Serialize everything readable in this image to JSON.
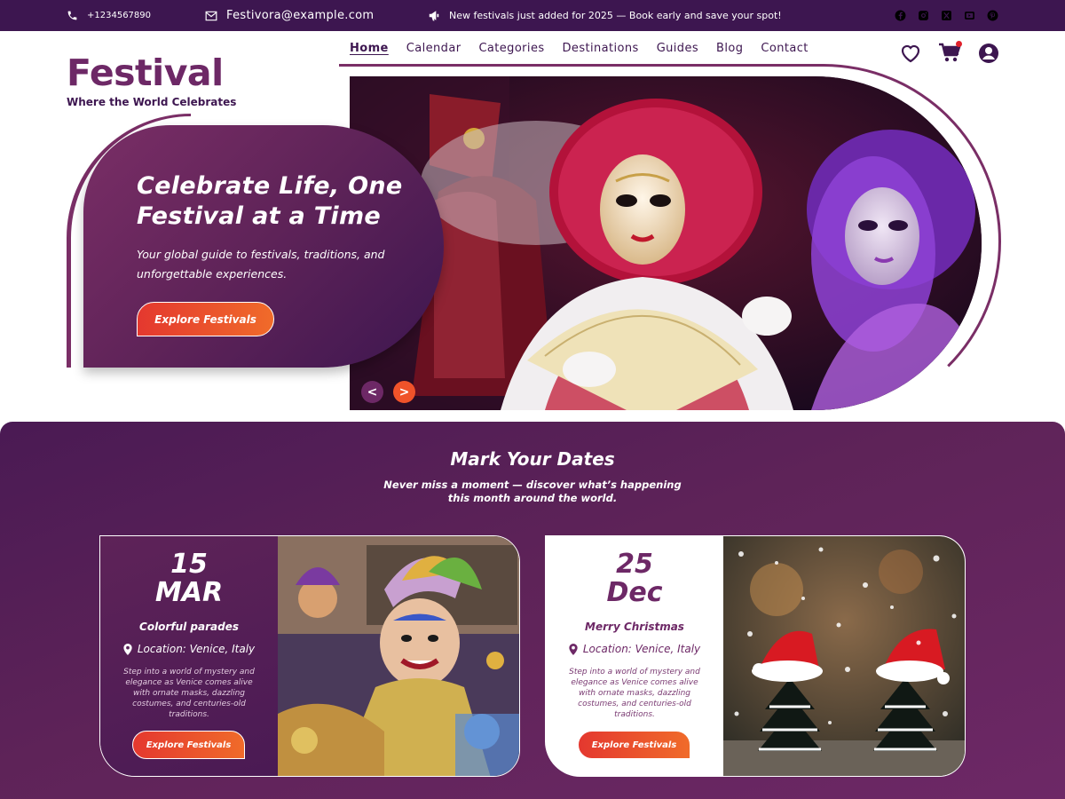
{
  "topbar": {
    "phone": "+1234567890",
    "email": "Festivora@example.com",
    "announcement": "New festivals just added for 2025 — Book early and save your spot!",
    "socials": [
      "facebook-icon",
      "instagram-icon",
      "x-icon",
      "youtube-icon",
      "pinterest-icon"
    ]
  },
  "brand": {
    "name": "Festival",
    "tagline": "Where the World Celebrates"
  },
  "nav": {
    "items": [
      "Home",
      "Calendar",
      "Categories",
      "Destinations",
      "Guides",
      "Blog",
      "Contact"
    ],
    "active": "Home"
  },
  "header_icons": [
    "heart-icon",
    "cart-icon",
    "user-icon"
  ],
  "hero": {
    "title_line1": "Celebrate Life, One",
    "title_line2": "Festival at a Time",
    "subtitle": "Your global guide to festivals, traditions, and unforgettable experiences.",
    "button": "Explore Festivals",
    "prev": "<",
    "next": ">"
  },
  "dates": {
    "title": "Mark Your Dates",
    "subtitle": "Never miss a moment — discover what’s happening this month around the world.",
    "events": [
      {
        "day": "15",
        "month": "MAR",
        "name": "Colorful parades",
        "location": "Location: Venice, Italy",
        "description": "Step into a world of mystery and elegance as Venice comes alive with ornate masks, dazzling costumes, and centuries-old traditions.",
        "button": "Explore Festivals"
      },
      {
        "day": "25",
        "month": "Dec",
        "name": "Merry Christmas",
        "location": "Location: Venice, Italy",
        "description": "Step into a world of mystery and elegance as Venice comes alive with ornate masks, dazzling costumes, and centuries-old traditions.",
        "button": "Explore Festivals"
      }
    ]
  },
  "colors": {
    "primary": "#6d2866",
    "dark": "#3d1650",
    "accent": "#f0532a"
  }
}
